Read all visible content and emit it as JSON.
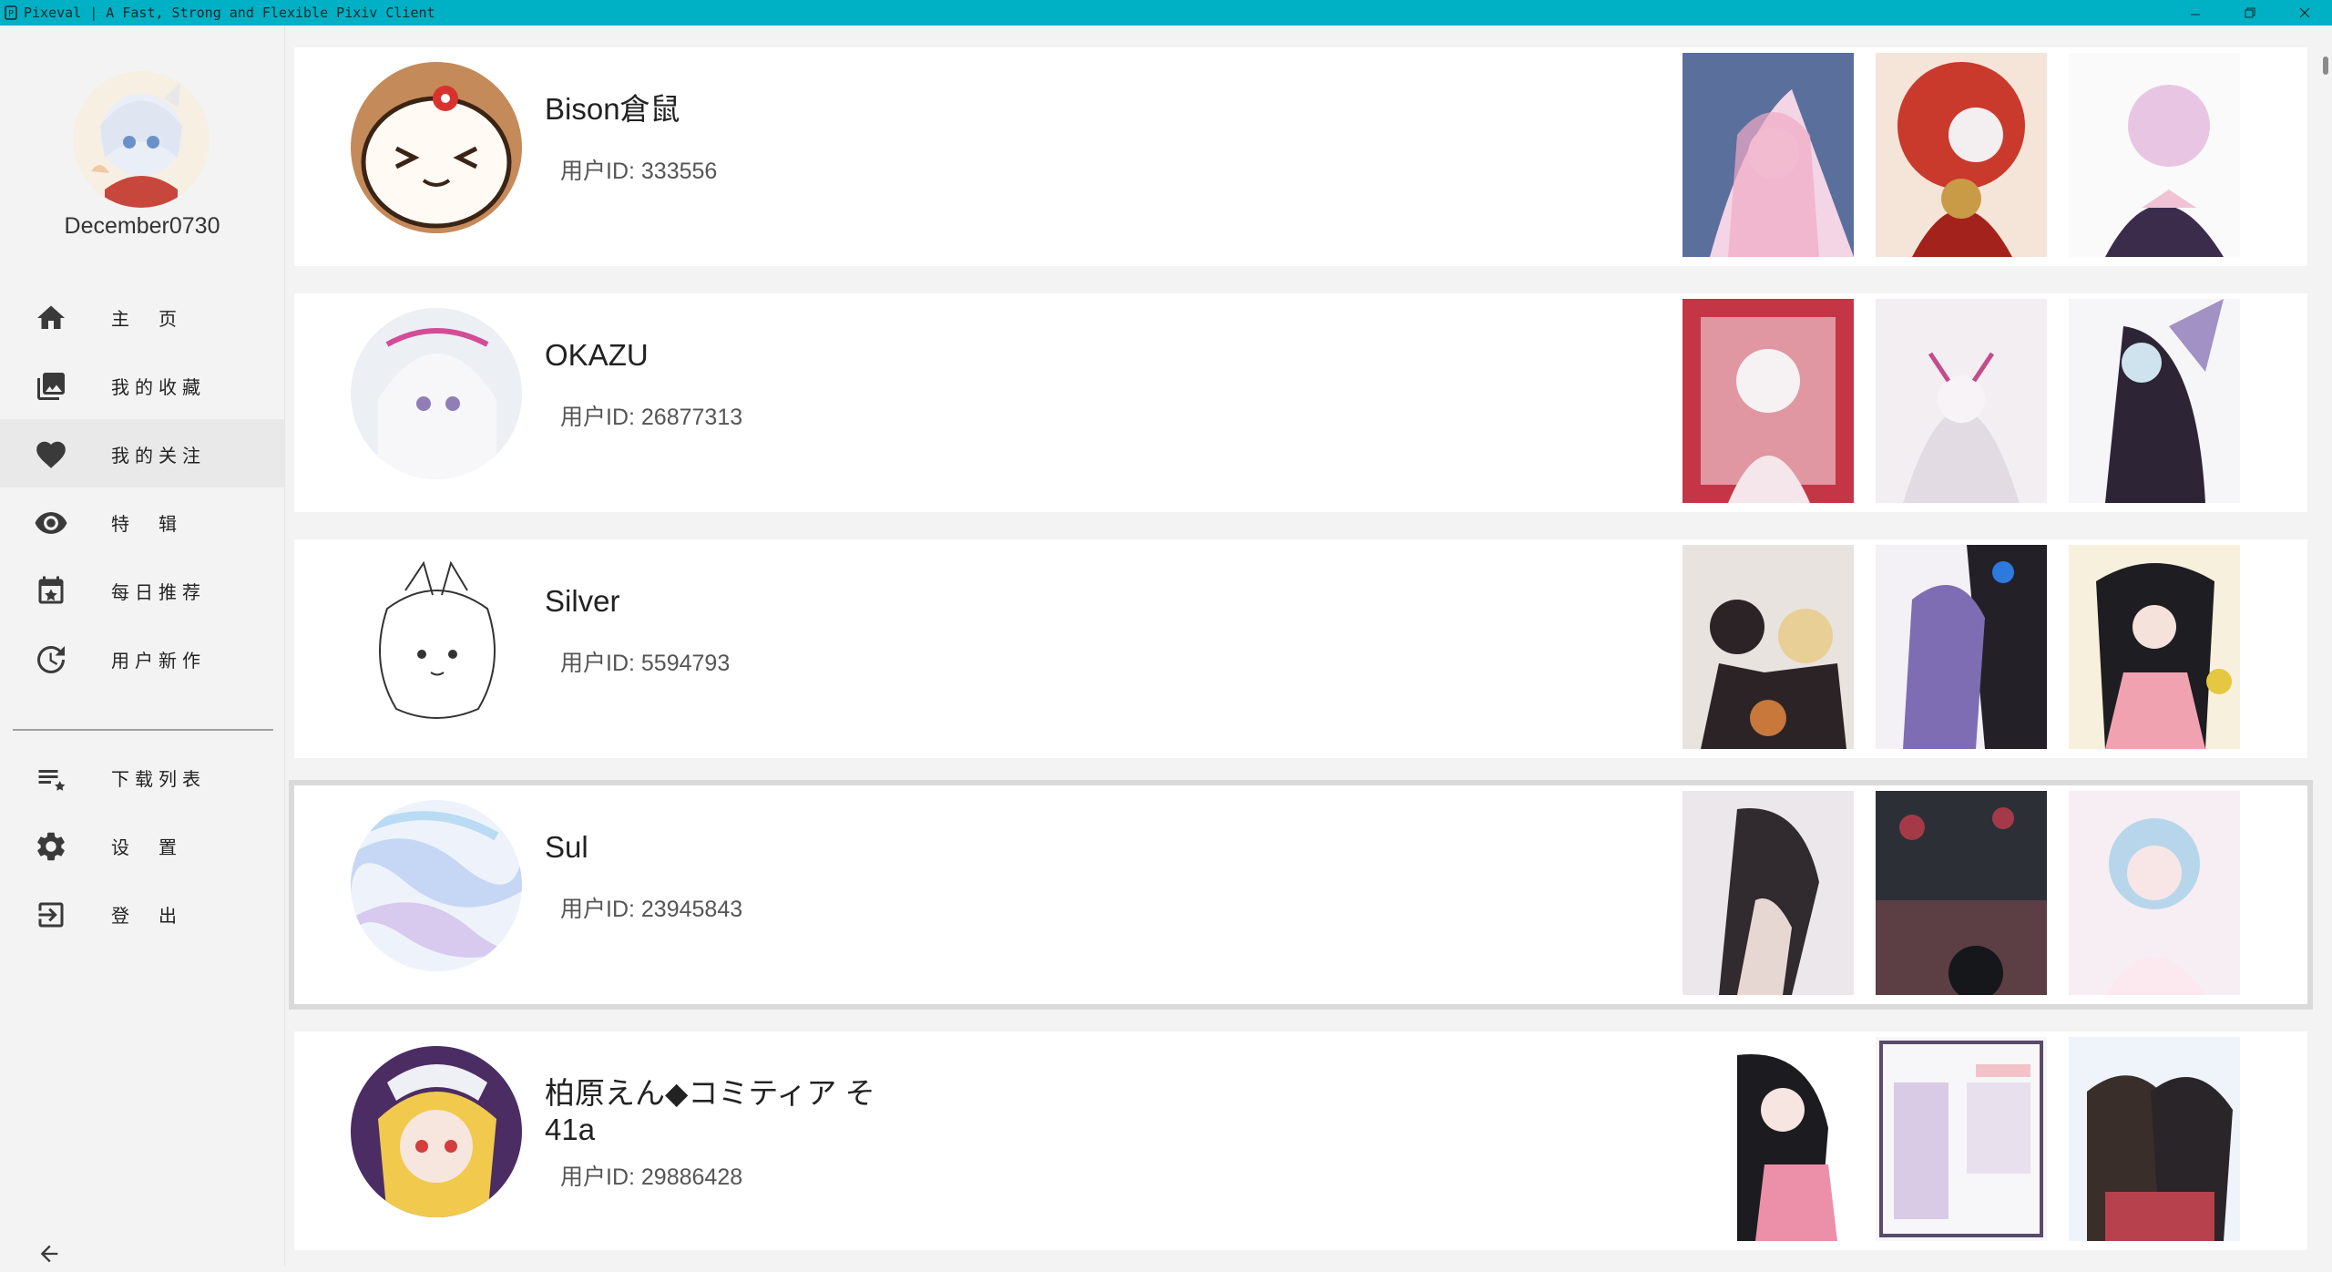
{
  "window": {
    "title": "Pixeval | A Fast, Strong and Flexible Pixiv Client",
    "controls": [
      "minimize",
      "maximize",
      "close"
    ]
  },
  "sidebar": {
    "username": "December0730",
    "items": [
      {
        "label": "主　页",
        "icon": "home-icon",
        "active": false
      },
      {
        "label": "我的收藏",
        "icon": "gallery-icon",
        "active": false
      },
      {
        "label": "我的关注",
        "icon": "heart-icon",
        "active": true
      },
      {
        "label": "特　辑",
        "icon": "eye-icon",
        "active": false
      },
      {
        "label": "每日推荐",
        "icon": "calendar-icon",
        "active": false
      },
      {
        "label": "用户新作",
        "icon": "history-icon",
        "active": false
      },
      {
        "label": "下载列表",
        "icon": "playlist-star-icon",
        "active": false
      },
      {
        "label": "设　置",
        "icon": "gear-icon",
        "active": false
      },
      {
        "label": "登　出",
        "icon": "logout-icon",
        "active": false
      }
    ]
  },
  "users": [
    {
      "name": "Bison倉鼠",
      "id_text": "用户ID: 333556",
      "selected": false
    },
    {
      "name": "OKAZU",
      "id_text": "用户ID: 26877313",
      "selected": false
    },
    {
      "name": "Silver",
      "id_text": "用户ID: 5594793",
      "selected": false
    },
    {
      "name": "Sul",
      "id_text": "用户ID: 23945843",
      "selected": true
    },
    {
      "name": "柏原えん◆コミティア そ41a",
      "id_text": "用户ID: 29886428",
      "selected": false
    }
  ],
  "colors": {
    "titlebar": "#00b0c4",
    "sidebar_bg": "#f3f3f3",
    "active_item": "#e9e9e9",
    "icon": "#3a3a3a"
  }
}
